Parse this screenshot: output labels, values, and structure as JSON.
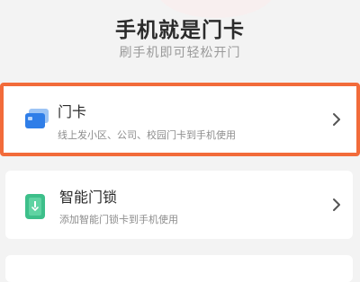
{
  "header": {
    "title": "手机就是门卡",
    "subtitle": "刷手机即可轻松开门"
  },
  "cards": [
    {
      "name": "门卡",
      "description": "线上发小区、公司、校园门卡到手机使用",
      "icon": "card-icon",
      "selected": true,
      "accent": "#2f7ee8"
    },
    {
      "name": "智能门锁",
      "description": "添加智能门锁卡到手机使用",
      "icon": "smart-lock-icon",
      "selected": false,
      "accent": "#3dbf8a"
    }
  ],
  "colors": {
    "background": "#f3f3f3",
    "selection_border": "#f26b3a",
    "card_background": "#ffffff"
  }
}
